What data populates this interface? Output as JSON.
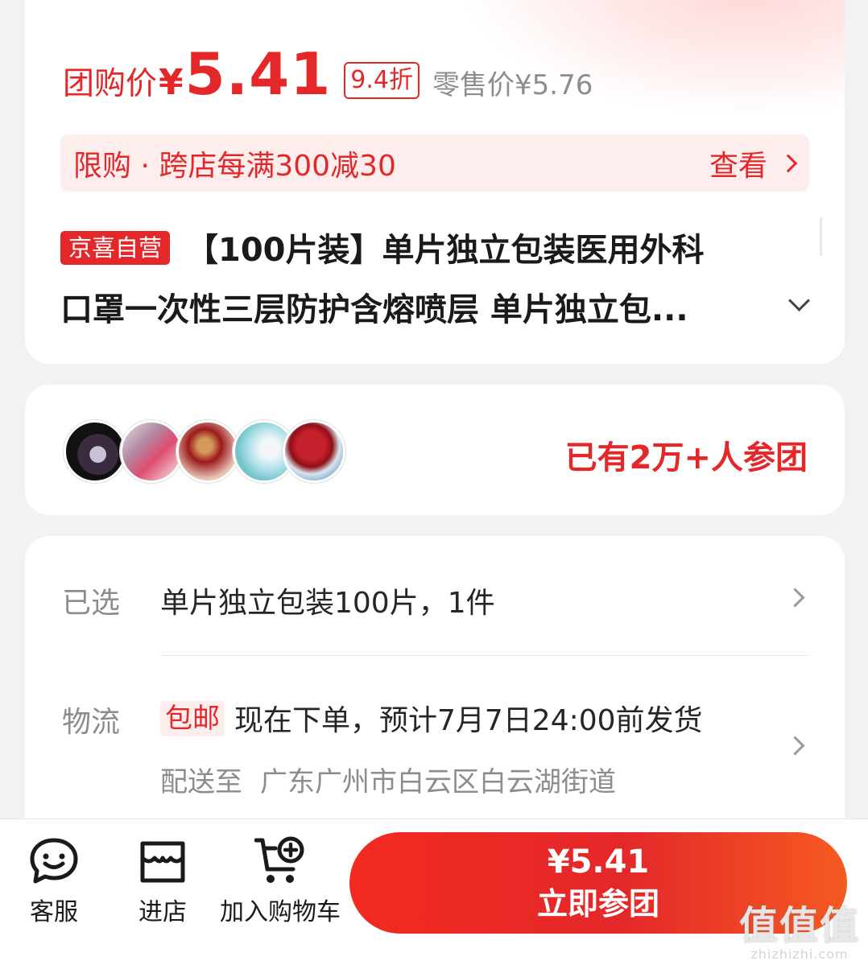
{
  "price_card": {
    "price_label": "团购价",
    "currency": "¥",
    "price": "5.41",
    "discount": "9.4折",
    "retail_price": "零售价¥5.76",
    "promo_text": "限购 · 跨店每满300减30",
    "promo_link": "查看",
    "self_operated_badge": "京喜自营",
    "title_line1": "【100片装】单片独立包装医用外科",
    "title_line2": "口罩一次性三层防护含熔喷层 单片独立包..."
  },
  "group_card": {
    "join_count_text": "已有2万+人参团"
  },
  "detail_card": {
    "selected_label": "已选",
    "selected_value": "单片独立包装100片，1件",
    "logistics_label": "物流",
    "free_shipping_badge": "包邮",
    "shipping_text": "现在下单，预计7月7日24:00前发货",
    "deliver_to_label": "配送至",
    "deliver_to_address": "广东广州市白云区白云湖街道"
  },
  "bottom_bar": {
    "service_label": "客服",
    "store_label": "进店",
    "cart_label": "加入购物车",
    "join_price": "¥5.41",
    "join_label": "立即参团"
  },
  "watermark": {
    "logo": "值值值",
    "url": "zhizhizhi.com"
  },
  "colors": {
    "accent": "#e4282a",
    "promo_bg": "#fdeeed",
    "page_bg": "#f2f2f2"
  }
}
